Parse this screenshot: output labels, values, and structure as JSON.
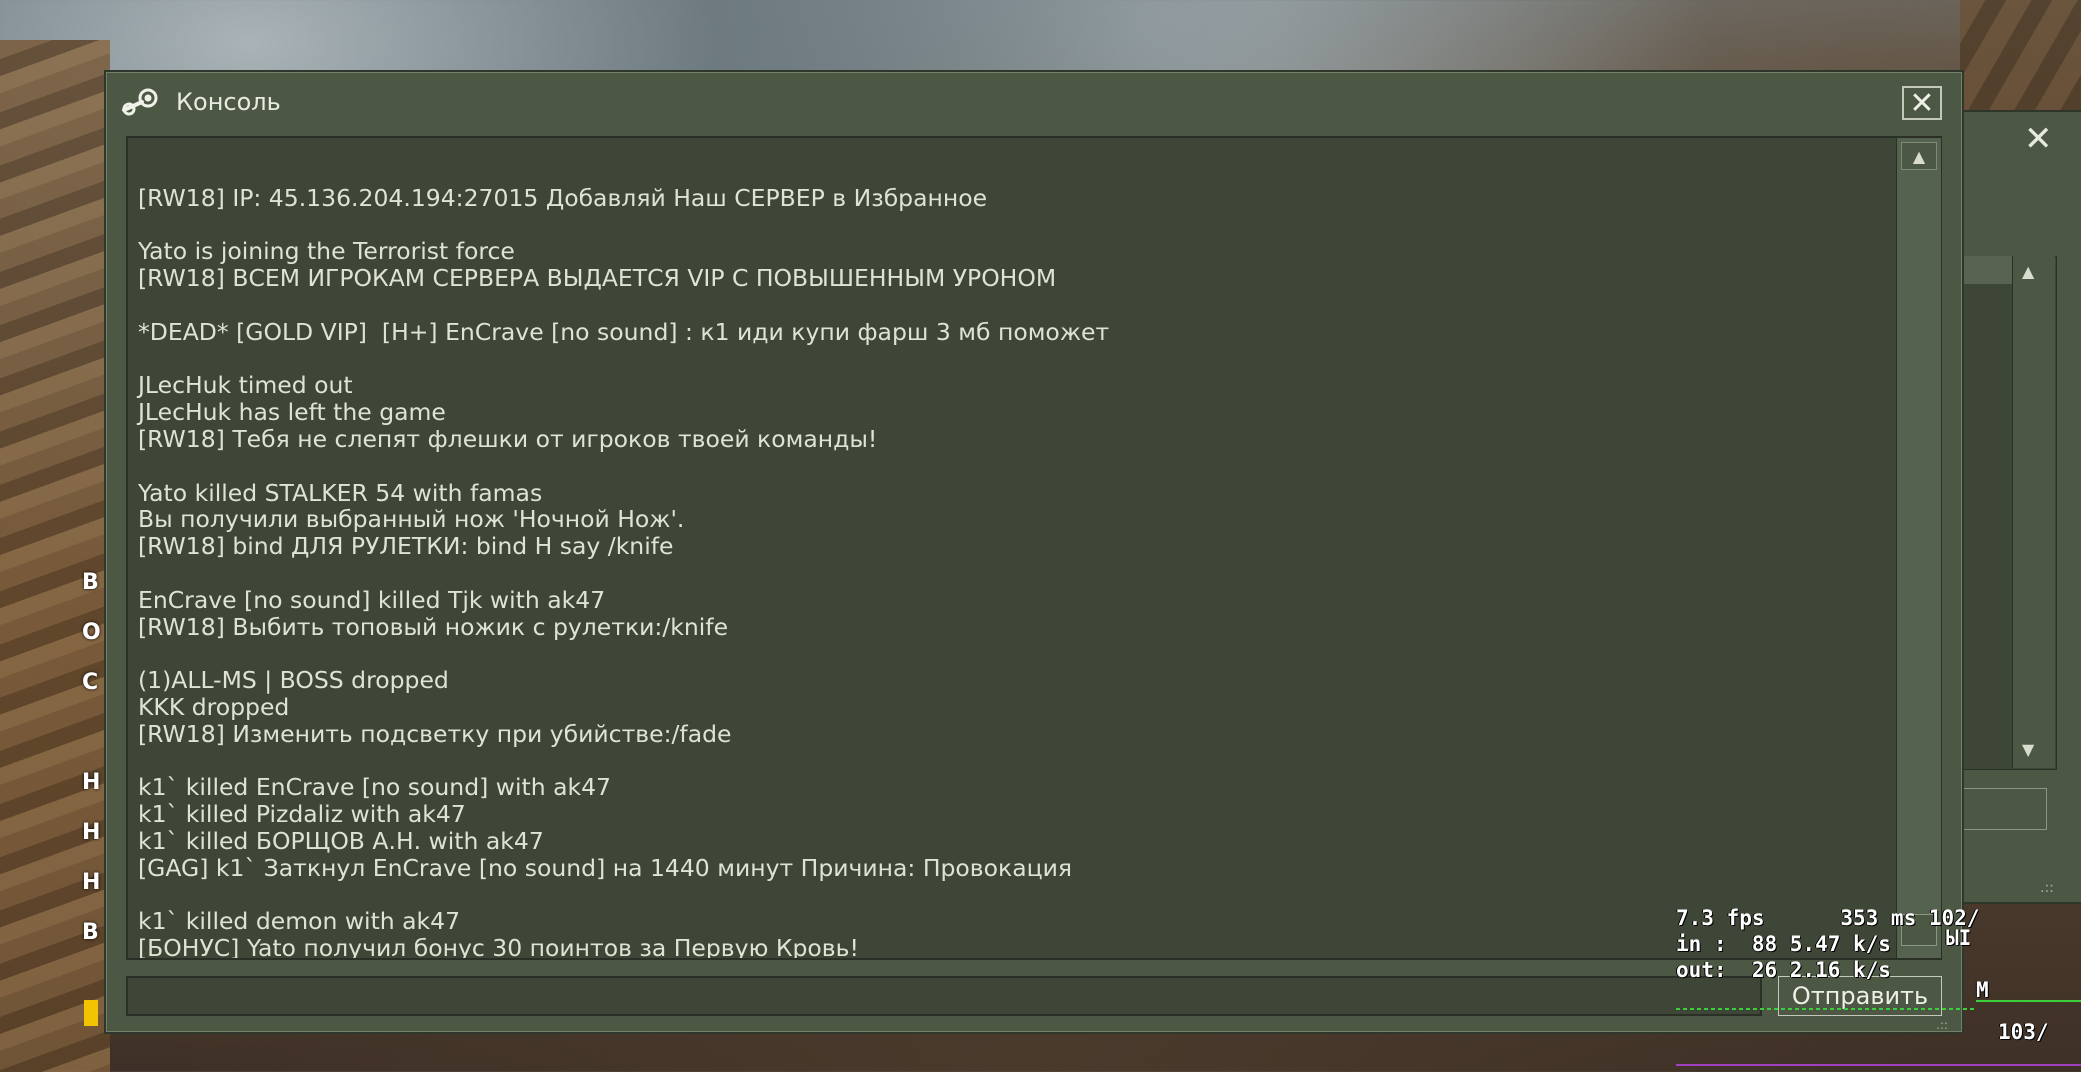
{
  "console": {
    "title": "Консоль",
    "close_label": "✕",
    "send_label": "Отправить",
    "input_value": "",
    "log": [
      "",
      "[RW18] IP: 45.136.204.194:27015 Добавляй Наш СЕРВЕР в Избранное",
      "",
      "Yato is joining the Terrorist force",
      "[RW18] ВСЕМ ИГРОКАМ СЕРВЕРА ВЫДАЕТСЯ VIP С ПОВЫШЕННЫМ УРОНОМ",
      "",
      "*DEAD* [GOLD VIP]  [H+] EnCrave [no sound] : к1 иди купи фарш 3 мб поможет",
      "",
      "JLecHuk timed out",
      "JLecHuk has left the game",
      "[RW18] Тебя не слепят флешки от игроков твоей команды!",
      "",
      "Yato killed STALKER 54 with famas",
      "Вы получили выбранный нож 'Ночной Нож'.",
      "[RW18] bind ДЛЯ РУЛЕТКИ: bind H say /knife",
      "",
      "EnCrave [no sound] killed Tjk with ak47",
      "[RW18] Выбить топовый ножик с рулетки:/knife",
      "",
      "(1)ALL-MS | BOSS dropped",
      "KKK dropped",
      "[RW18] Изменить подсветку при убийстве:/fade",
      "",
      "k1` killed EnCrave [no sound] with ak47",
      "k1` killed Pizdaliz with ak47",
      "k1` killed БОРЩОВ А.Н. with ak47",
      "[GAG] k1` Заткнул EnCrave [no sound] на 1440 минут Причина: Провокация",
      "",
      "k1` killed demon with ak47",
      "[БОНУС] Yato получил бонус 30 поинтов за Первую Кровь!"
    ]
  },
  "background_window": {
    "close_label": "✕",
    "scroll_up": "▲",
    "scroll_down": "▼"
  },
  "hud": {
    "left_letters": [
      "В",
      "О",
      "С",
      "Н",
      "Н",
      "Н",
      "В"
    ]
  },
  "netgraph": {
    "line1": "7.3 fps      353 ms 102/",
    "line2": "in :  88 5.47 k/s",
    "line3": "out:  26 2.16 k/s",
    "extra1": "ЫI",
    "extra2": "M",
    "extra3": "103/"
  },
  "colors": {
    "window_bg": "#4c5844",
    "panel_bg": "#3e4637",
    "text": "#dfe3d4"
  }
}
